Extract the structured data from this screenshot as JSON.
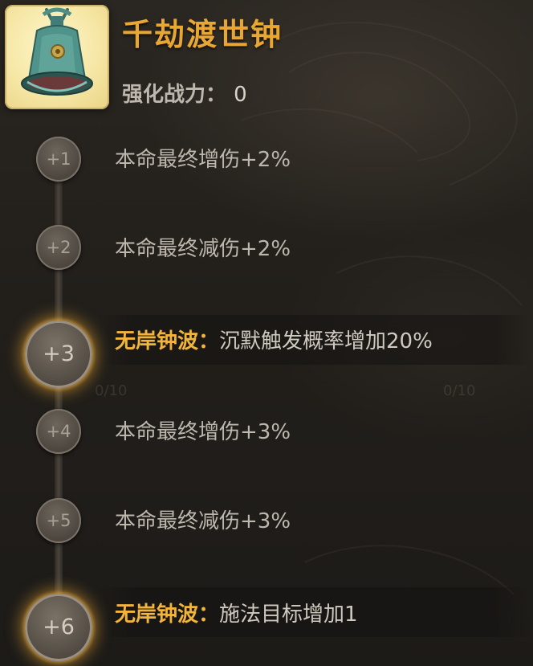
{
  "item": {
    "name": "千劫渡世钟",
    "icon": "bronze-bell-icon",
    "power_label": "强化战力：",
    "power_value": "0"
  },
  "levels": [
    {
      "label": "+1",
      "effect": "本命最终增伤+2%"
    },
    {
      "label": "+2",
      "effect": "本命最终减伤+2%"
    },
    {
      "label": "+3",
      "skill_name": "无岸钟波：",
      "skill_desc": "沉默触发概率增加20%"
    },
    {
      "label": "+4",
      "effect": "本命最终增伤+3%"
    },
    {
      "label": "+5",
      "effect": "本命最终减伤+3%"
    },
    {
      "label": "+6",
      "skill_name": "无岸钟波：",
      "skill_desc": "施法目标增加1"
    }
  ],
  "background_text": [
    "0/10",
    "0/10"
  ],
  "colors": {
    "title": "#e8a632",
    "skill_name": "#f2b43a",
    "glow": "#e8a632",
    "text": "#bdb7ad"
  }
}
